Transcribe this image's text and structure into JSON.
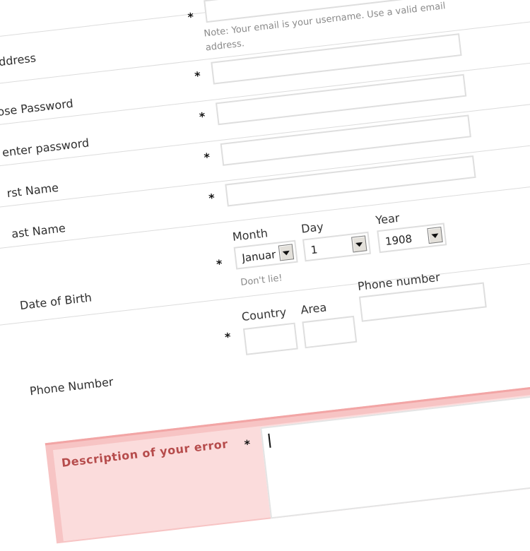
{
  "form": {
    "email": {
      "label": "address",
      "required": "*",
      "note": "Note: Your email is your username. Use a valid email address."
    },
    "password": {
      "label": "ose Password",
      "required": "*"
    },
    "reenter": {
      "label": "enter password",
      "required": "*"
    },
    "first_name": {
      "label": "rst Name",
      "required": "*"
    },
    "last_name": {
      "label": "ast Name",
      "required": "*"
    },
    "dob": {
      "label": "Date of Birth",
      "required": "*",
      "month_label": "Month",
      "month_value": "Januar",
      "day_label": "Day",
      "day_value": "1",
      "year_label": "Year",
      "year_value": "1908",
      "note": "Don't lie!"
    },
    "phone": {
      "label": "Phone Number",
      "required": "*",
      "country_label": "Country",
      "area_label": "Area",
      "number_label": "Phone number"
    },
    "error": {
      "title": "Description of your error",
      "required": "*"
    }
  },
  "colors": {
    "error_outer": "#f7c4c4",
    "error_inner": "#fbdcdc",
    "error_title": "#b64c4c",
    "field_border": "#dedede"
  }
}
